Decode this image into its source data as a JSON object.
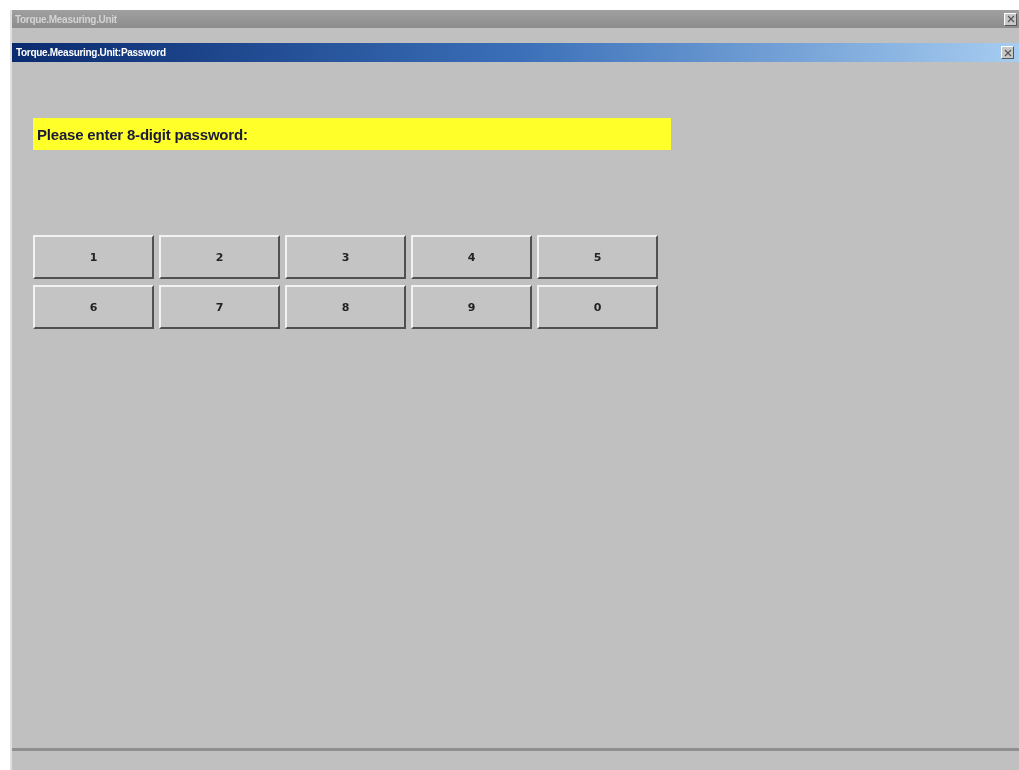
{
  "window": {
    "title": "Torque.Measuring.Unit"
  },
  "dialog": {
    "title": "Torque.Measuring.Unit:Password"
  },
  "prompt": "Please enter 8-digit password:",
  "keys": [
    "1",
    "2",
    "3",
    "4",
    "5",
    "6",
    "7",
    "8",
    "9",
    "0"
  ]
}
